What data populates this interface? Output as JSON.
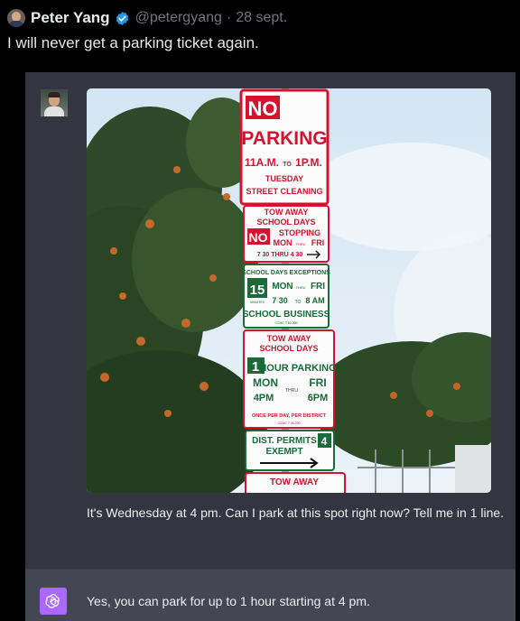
{
  "tweet": {
    "author_name": "Peter Yang",
    "handle": "@petergyang",
    "separator": "·",
    "date": "28 sept.",
    "text": "I will never get a parking ticket again.",
    "verified_color": "#1d9bf0"
  },
  "chat": {
    "user_message": "It's Wednesday at 4 pm. Can I park at this spot right now? Tell me in 1 line.",
    "assistant_message": "Yes, you can park for up to 1 hour starting at 4 pm.",
    "assistant_avatar_color": "#ab68ff"
  },
  "signs": {
    "no_parking": {
      "no": "NO",
      "parking": "PARKING",
      "time_start": "11A.M.",
      "to": "TO",
      "time_end": "1P.M.",
      "day": "TUESDAY",
      "purpose": "STREET CLEANING"
    },
    "tow_school_days": {
      "tow_away": "TOW AWAY",
      "school_days": "SCHOOL DAYS",
      "no": "NO",
      "stopping": "STOPPING",
      "mon": "MON",
      "thru": "THRU",
      "fri": "FRI",
      "times": "7 30 THRU 4 30"
    },
    "exceptions": {
      "title": "SCHOOL DAYS EXCEPTIONS",
      "minutes_number": "15",
      "minutes": "MINUTES",
      "mon": "MON",
      "thru": "THRU",
      "fri": "FRI",
      "time_start": "7 30",
      "to": "TO",
      "time_end": "8 AM",
      "business": "SCHOOL BUSINESS",
      "code": "CCMC 7.63.200"
    },
    "tow_hour": {
      "tow_away": "TOW AWAY",
      "school_days": "SCHOOL DAYS",
      "hour_number": "1",
      "hour_parking": "HOUR PARKING",
      "mon": "MON",
      "thru": "THRU",
      "fri": "FRI",
      "time_start": "4PM",
      "time_end": "6PM",
      "once": "ONCE PER DAY, PER DISTRICT",
      "code": "CCMC 7.45.200"
    },
    "dist_permits": {
      "line1": "DIST. PERMITS",
      "line2": "EXEMPT",
      "district": "4"
    },
    "bottom": {
      "tow_away": "TOW AWAY"
    }
  },
  "colors": {
    "sign_red": "#d4142e",
    "sign_green": "#1a6a3a",
    "chat_bg": "#343541",
    "assistant_bg": "#444654"
  }
}
